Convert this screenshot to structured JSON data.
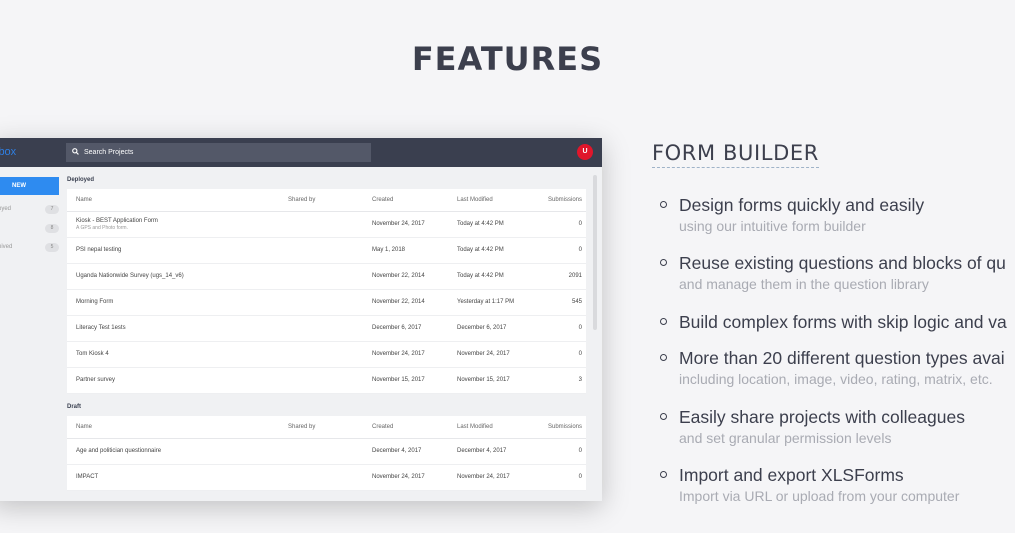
{
  "page": {
    "title": "FEATURES"
  },
  "mock": {
    "logo": "lbox",
    "search_placeholder": "Search Projects",
    "avatar_letter": "U",
    "new_button": "NEW",
    "sidebar": [
      {
        "label": "oyed",
        "count": "7"
      },
      {
        "label": "t",
        "count": "8"
      },
      {
        "label": "hived",
        "count": "5"
      }
    ],
    "deployed": {
      "label": "Deployed",
      "headers": {
        "name": "Name",
        "shared": "Shared by",
        "created": "Created",
        "modified": "Last Modified",
        "submissions": "Submissions"
      },
      "rows": [
        {
          "name": "Kiosk - BEST Application Form",
          "sub": "A GPS and Photo form.",
          "shared": "",
          "created": "November 24, 2017",
          "modified": "Today at 4:42 PM",
          "submissions": "0"
        },
        {
          "name": "PSI nepal testing",
          "sub": "",
          "shared": "",
          "created": "May 1, 2018",
          "modified": "Today at 4:42 PM",
          "submissions": "0"
        },
        {
          "name": "Uganda Nationwide Survey (ugs_14_v6)",
          "sub": "",
          "shared": "",
          "created": "November 22, 2014",
          "modified": "Today at 4:42 PM",
          "submissions": "2091"
        },
        {
          "name": "Morning Form",
          "sub": "",
          "shared": "",
          "created": "November 22, 2014",
          "modified": "Yesterday at 1:17 PM",
          "submissions": "545"
        },
        {
          "name": "Literacy Test 1ests",
          "sub": "",
          "shared": "",
          "created": "December 6, 2017",
          "modified": "December 6, 2017",
          "submissions": "0"
        },
        {
          "name": "Tom Kiosk 4",
          "sub": "",
          "shared": "",
          "created": "November 24, 2017",
          "modified": "November 24, 2017",
          "submissions": "0"
        },
        {
          "name": "Partner survey",
          "sub": "",
          "shared": "",
          "created": "November 15, 2017",
          "modified": "November 15, 2017",
          "submissions": "3"
        }
      ]
    },
    "draft": {
      "label": "Draft",
      "headers": {
        "name": "Name",
        "shared": "Shared by",
        "created": "Created",
        "modified": "Last Modified",
        "submissions": "Submissions"
      },
      "rows": [
        {
          "name": "Age and politician questionnaire",
          "sub": "",
          "shared": "",
          "created": "December 4, 2017",
          "modified": "December 4, 2017",
          "submissions": "0"
        },
        {
          "name": "IMPACT",
          "sub": "",
          "shared": "",
          "created": "November 24, 2017",
          "modified": "November 24, 2017",
          "submissions": "0"
        }
      ]
    }
  },
  "features": {
    "title": "FORM BUILDER",
    "items": [
      {
        "main": "Design forms quickly and easily",
        "sub": "using our intuitive form builder"
      },
      {
        "main": "Reuse existing questions and blocks of qu",
        "sub": "and manage them in the question library"
      },
      {
        "main": "Build complex forms with skip logic and va",
        "sub": ""
      },
      {
        "main": "More than 20 different question types avai",
        "sub": "including location, image, video, rating, matrix, etc."
      },
      {
        "main": "Easily share projects with colleagues",
        "sub": "and set granular permission levels"
      },
      {
        "main": "Import and export XLSForms",
        "sub": "Import via URL or upload from your computer"
      }
    ]
  }
}
